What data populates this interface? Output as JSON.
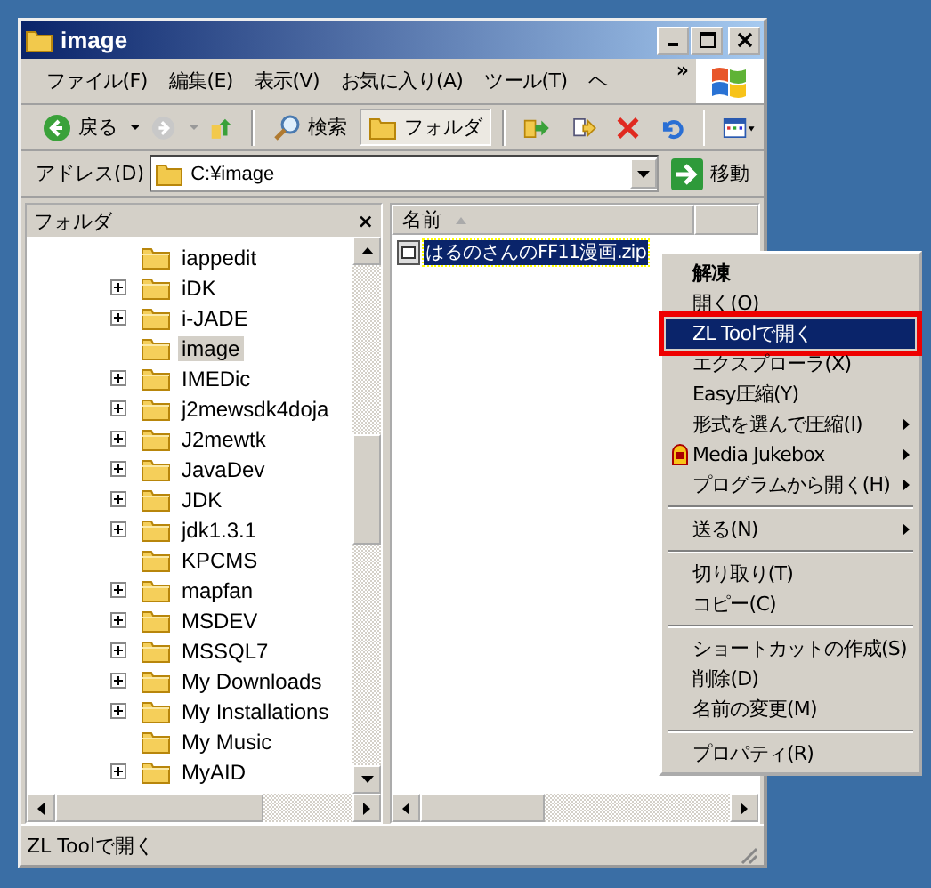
{
  "window": {
    "title": "image"
  },
  "menu_bar": {
    "items": [
      "ファイル(F)",
      "編集(E)",
      "表示(V)",
      "お気に入り(A)",
      "ツール(T)",
      "ヘ"
    ],
    "more": "»"
  },
  "toolbar": {
    "back": "戻る",
    "search": "検索",
    "folders": {
      "label": "フォルダ",
      "pressed": true
    }
  },
  "address_bar": {
    "label": "アドレス(D)",
    "value": "C:¥image",
    "go": "移動"
  },
  "folder_pane": {
    "title": "フォルダ",
    "close": "×",
    "items": [
      {
        "label": "iappedit",
        "expandable": false,
        "selected": false
      },
      {
        "label": "iDK",
        "expandable": true,
        "selected": false
      },
      {
        "label": "i-JADE",
        "expandable": true,
        "selected": false
      },
      {
        "label": "image",
        "expandable": false,
        "selected": true
      },
      {
        "label": "IMEDic",
        "expandable": true,
        "selected": false
      },
      {
        "label": "j2mewsdk4doja",
        "expandable": true,
        "selected": false
      },
      {
        "label": "J2mewtk",
        "expandable": true,
        "selected": false
      },
      {
        "label": "JavaDev",
        "expandable": true,
        "selected": false
      },
      {
        "label": "JDK",
        "expandable": true,
        "selected": false
      },
      {
        "label": "jdk1.3.1",
        "expandable": true,
        "selected": false
      },
      {
        "label": "KPCMS",
        "expandable": false,
        "selected": false
      },
      {
        "label": "mapfan",
        "expandable": true,
        "selected": false
      },
      {
        "label": "MSDEV",
        "expandable": true,
        "selected": false
      },
      {
        "label": "MSSQL7",
        "expandable": true,
        "selected": false
      },
      {
        "label": "My Downloads",
        "expandable": true,
        "selected": false
      },
      {
        "label": "My Installations",
        "expandable": true,
        "selected": false
      },
      {
        "label": "My Music",
        "expandable": false,
        "selected": false
      },
      {
        "label": "MyAID",
        "expandable": true,
        "selected": false
      }
    ]
  },
  "file_list": {
    "columns": [
      "名前"
    ],
    "rows": [
      {
        "name": "はるのさんのFF11漫画.zip",
        "selected": true
      }
    ]
  },
  "context_menu": {
    "items": [
      {
        "kind": "item",
        "label": "解凍",
        "bold": true,
        "selected": false,
        "submenu": false
      },
      {
        "kind": "item",
        "label": "開く(O)",
        "bold": false,
        "selected": false,
        "submenu": false
      },
      {
        "kind": "item",
        "label": "ZL Toolで開く",
        "bold": false,
        "selected": true,
        "outlined": true,
        "submenu": false
      },
      {
        "kind": "item",
        "label": "エクスプローラ(X)",
        "bold": false,
        "selected": false,
        "submenu": false
      },
      {
        "kind": "item",
        "label": "Easy圧縮(Y)",
        "bold": false,
        "selected": false,
        "submenu": false
      },
      {
        "kind": "item",
        "label": "形式を選んで圧縮(I)",
        "bold": false,
        "selected": false,
        "submenu": true
      },
      {
        "kind": "item",
        "label": "Media Jukebox",
        "bold": false,
        "selected": false,
        "submenu": true,
        "icon": true
      },
      {
        "kind": "item",
        "label": "プログラムから開く(H)",
        "bold": false,
        "selected": false,
        "submenu": true
      },
      {
        "kind": "separator"
      },
      {
        "kind": "item",
        "label": "送る(N)",
        "bold": false,
        "selected": false,
        "submenu": true
      },
      {
        "kind": "separator"
      },
      {
        "kind": "item",
        "label": "切り取り(T)",
        "bold": false,
        "selected": false,
        "submenu": false
      },
      {
        "kind": "item",
        "label": "コピー(C)",
        "bold": false,
        "selected": false,
        "submenu": false
      },
      {
        "kind": "separator"
      },
      {
        "kind": "item",
        "label": "ショートカットの作成(S)",
        "bold": false,
        "selected": false,
        "submenu": false
      },
      {
        "kind": "item",
        "label": "削除(D)",
        "bold": false,
        "selected": false,
        "submenu": false
      },
      {
        "kind": "item",
        "label": "名前の変更(M)",
        "bold": false,
        "selected": false,
        "submenu": false
      },
      {
        "kind": "separator"
      },
      {
        "kind": "item",
        "label": "プロパティ(R)",
        "bold": false,
        "selected": false,
        "submenu": false
      }
    ]
  },
  "status_bar": {
    "text": "ZL Toolで開く"
  }
}
